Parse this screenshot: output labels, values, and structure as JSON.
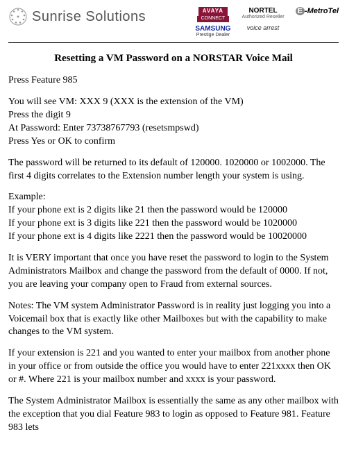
{
  "header": {
    "brand": "Sunrise Solutions",
    "logos": {
      "avaya": "AVAYA",
      "avaya_sub": "CONNECT",
      "nortel": "NORTEL",
      "nortel_sub": "Authorized Reseller",
      "emetro": "-MetroTel",
      "samsung": "SAMSUNG",
      "samsung_sub": "Prestige Dealer",
      "voice": "voice arrest"
    }
  },
  "title": "Resetting a VM Password on a NORSTAR Voice Mail",
  "steps": {
    "l1": "Press Feature 985",
    "l2": "You will see VM: XXX 9 (XXX is the extension of the VM)",
    "l3": "Press the digit 9",
    "l4": "At Password: Enter 73738767793 (resetsmpswd)",
    "l5": "Press Yes or OK to confirm"
  },
  "reset_info": "The password will be returned to its default of 120000. 1020000 or 1002000. The first 4 digits correlates to the Extension number length your system is using.",
  "example": {
    "h": "Example:",
    "e1": "If your phone ext is 2 digits like 21 then the password would be 120000",
    "e2": "If your phone ext is 3 digits like 221 then the password would be 1020000",
    "e3": "If your phone ext is 4 digits like 2221 then the password would be 10020000"
  },
  "important": "It is VERY important that once you have reset the password to login to the System Administrators Mailbox and change the password from the default of 0000. If not, you are leaving your company open to Fraud from external sources.",
  "notes": "Notes: The VM system Administrator Password is in reality just logging you into a Voicemail box that is exactly like other Mailboxes but with the capability to make changes to the VM system.",
  "ext_info": "If your extension is 221 and you wanted to enter your mailbox from another phone in your office or from outside the office you would have to enter 221xxxx then OK or #. Where 221 is your mailbox number and xxxx is your password.",
  "admin_info": "The System Administrator Mailbox is essentially the same as any other mailbox with the exception that you dial Feature 983 to login as opposed to Feature 981. Feature 983 lets"
}
